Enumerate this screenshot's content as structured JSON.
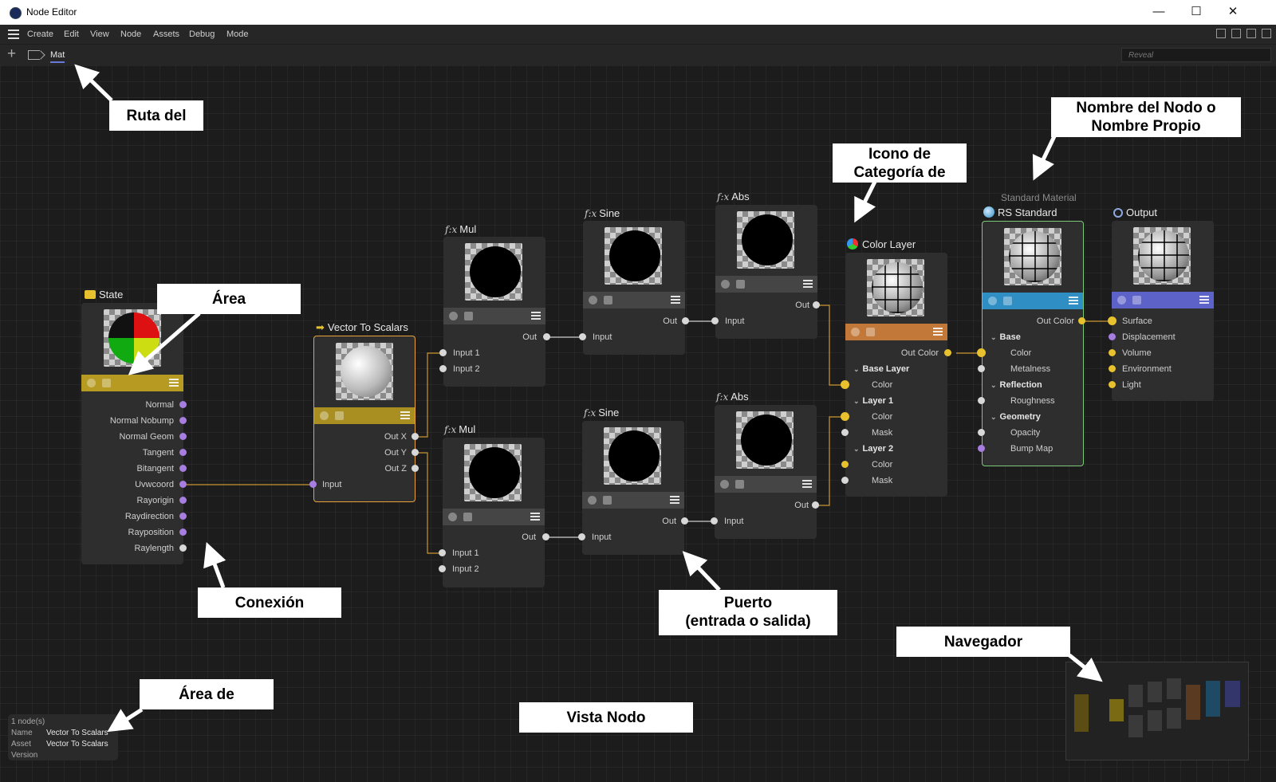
{
  "window": {
    "title": "Node Editor",
    "minimize": "—",
    "maximize": "☐",
    "close": "✕"
  },
  "menu": {
    "items": [
      "Create",
      "Edit",
      "View",
      "Node",
      "Assets",
      "Debug",
      "Mode"
    ]
  },
  "path": {
    "add": "+",
    "label": "Mat",
    "search_placeholder": "Reveal"
  },
  "nodes": {
    "state": {
      "title": "State",
      "ports": [
        "Normal",
        "Normal Nobump",
        "Normal Geom",
        "Tangent",
        "Bitangent",
        "Uvwcoord",
        "Rayorigin",
        "Raydirection",
        "Rayposition",
        "Raylength"
      ]
    },
    "vts": {
      "title": "Vector To Scalars",
      "outputs": [
        "Out X",
        "Out Y",
        "Out Z"
      ],
      "input": "Input"
    },
    "mul1": {
      "fx": "f:x",
      "title": "Mul",
      "output": "Out",
      "inputs": [
        "Input 1",
        "Input 2"
      ]
    },
    "mul2": {
      "fx": "f:x",
      "title": "Mul",
      "output": "Out",
      "inputs": [
        "Input 1",
        "Input 2"
      ]
    },
    "sine1": {
      "fx": "f:x",
      "title": "Sine",
      "output": "Out",
      "input": "Input"
    },
    "sine2": {
      "fx": "f:x",
      "title": "Sine",
      "output": "Out",
      "input": "Input"
    },
    "abs1": {
      "fx": "f:x",
      "title": "Abs",
      "output": "Out",
      "input": "Input"
    },
    "abs2": {
      "fx": "f:x",
      "title": "Abs",
      "output": "Out",
      "input": "Input"
    },
    "colorlayer": {
      "title": "Color Layer",
      "output": "Out Color",
      "groups": [
        "Base Layer",
        "Layer 1",
        "Layer 2"
      ],
      "color": "Color",
      "mask": "Mask"
    },
    "rsstandard": {
      "subtitle": "Standard Material",
      "title": "RS Standard",
      "output": "Out Color",
      "groups": [
        "Base",
        "Reflection",
        "Geometry"
      ],
      "ports": [
        "Color",
        "Metalness",
        "Roughness",
        "Opacity",
        "Bump Map"
      ]
    },
    "output": {
      "title": "Output",
      "ports": [
        "Surface",
        "Displacement",
        "Volume",
        "Environment",
        "Light"
      ]
    }
  },
  "callouts": {
    "ruta": "Ruta del",
    "nombre_l1": "Nombre del Nodo o",
    "nombre_l2": "Nombre Propio",
    "icono_l1": "Icono de",
    "icono_l2": "Categoría de",
    "area": "Área",
    "conexion": "Conexión",
    "puerto_l1": "Puerto",
    "puerto_l2": "(entrada o salida)",
    "navegador": "Navegador",
    "area_de": "Área de",
    "vista": "Vista Nodo"
  },
  "info": {
    "count": "1 node(s)",
    "name_label": "Name",
    "name_value": "Vector To Scalars",
    "asset_label": "Asset",
    "asset_value": "Vector To Scalars",
    "version_label": "Version"
  },
  "colors": {
    "state_bar": "#b69a21",
    "vts_bar": "#a98f22",
    "colorlayer_bar": "#c27839",
    "rs_bar": "#2f8fc4",
    "output_bar": "#5d62c8",
    "wire_orange": "#c9952f",
    "wire_white": "#cccccc",
    "selection": "#e9a33a",
    "port_purple": "#a77de0",
    "port_yellow": "#e8c12e"
  }
}
